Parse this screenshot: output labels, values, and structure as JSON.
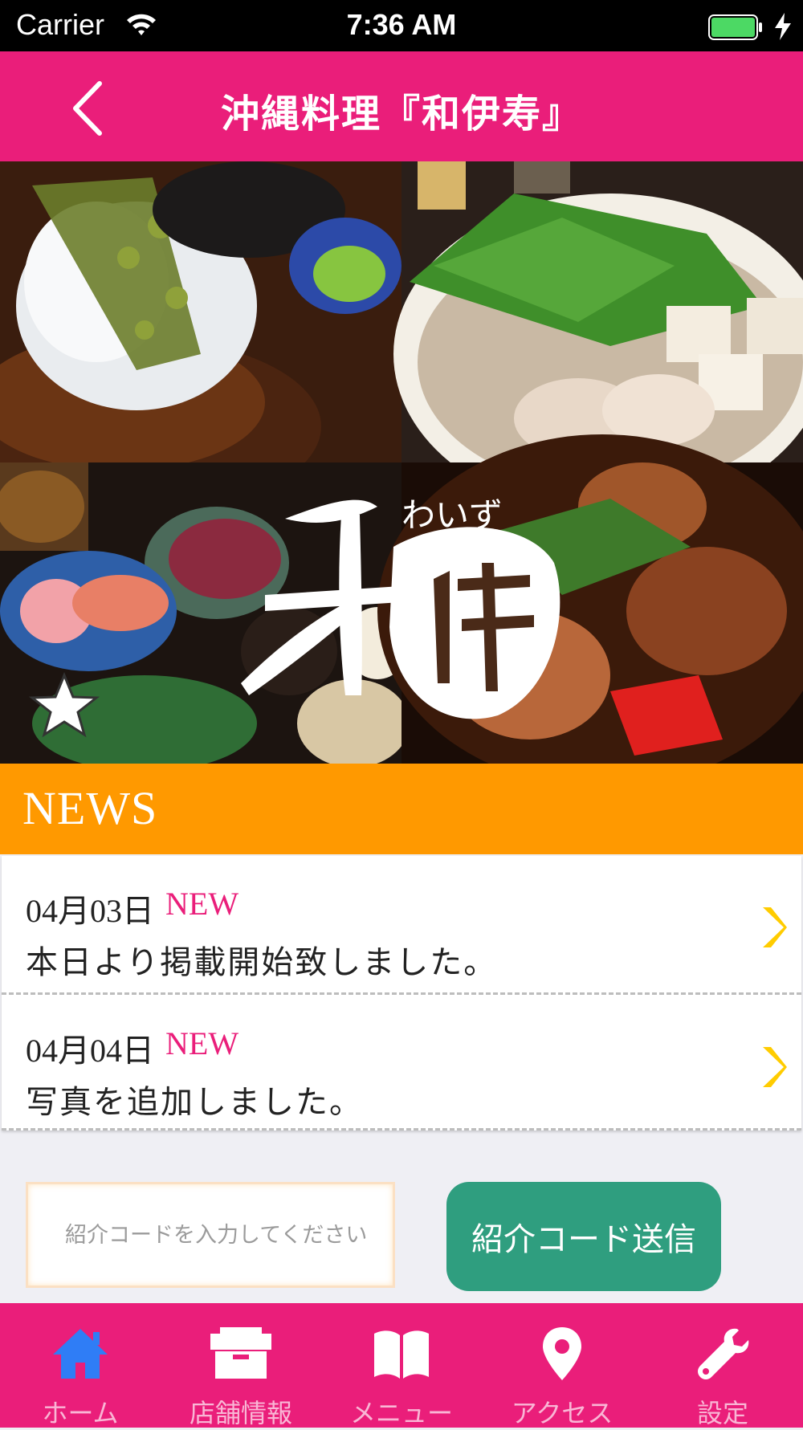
{
  "status_bar": {
    "carrier": "Carrier",
    "time": "7:36 AM"
  },
  "nav": {
    "title": "沖縄料理『和伊寿』"
  },
  "hero": {
    "logo_kana": "わいず",
    "logo_text": "和伊寿"
  },
  "news": {
    "title": "NEWS",
    "items": [
      {
        "date": "04月03日",
        "badge": "NEW",
        "text": "本日より掲載開始致しました。"
      },
      {
        "date": "04月04日",
        "badge": "NEW",
        "text": "写真を追加しました。"
      }
    ]
  },
  "referral": {
    "placeholder": "紹介コードを入力してください",
    "button_label": "紹介コード送信"
  },
  "tabs": [
    {
      "label": "ホーム",
      "icon": "home-icon",
      "active": true
    },
    {
      "label": "店舗情報",
      "icon": "shop-icon",
      "active": false
    },
    {
      "label": "メニュー",
      "icon": "book-icon",
      "active": false
    },
    {
      "label": "アクセス",
      "icon": "map-pin-icon",
      "active": false
    },
    {
      "label": "設定",
      "icon": "wrench-icon",
      "active": false
    }
  ],
  "colors": {
    "brand_pink": "#ea1e7a",
    "news_orange": "#ff9900",
    "button_green": "#2f9e7f",
    "active_tab_blue": "#2f7df6",
    "chevron_yellow": "#ffcc00"
  }
}
